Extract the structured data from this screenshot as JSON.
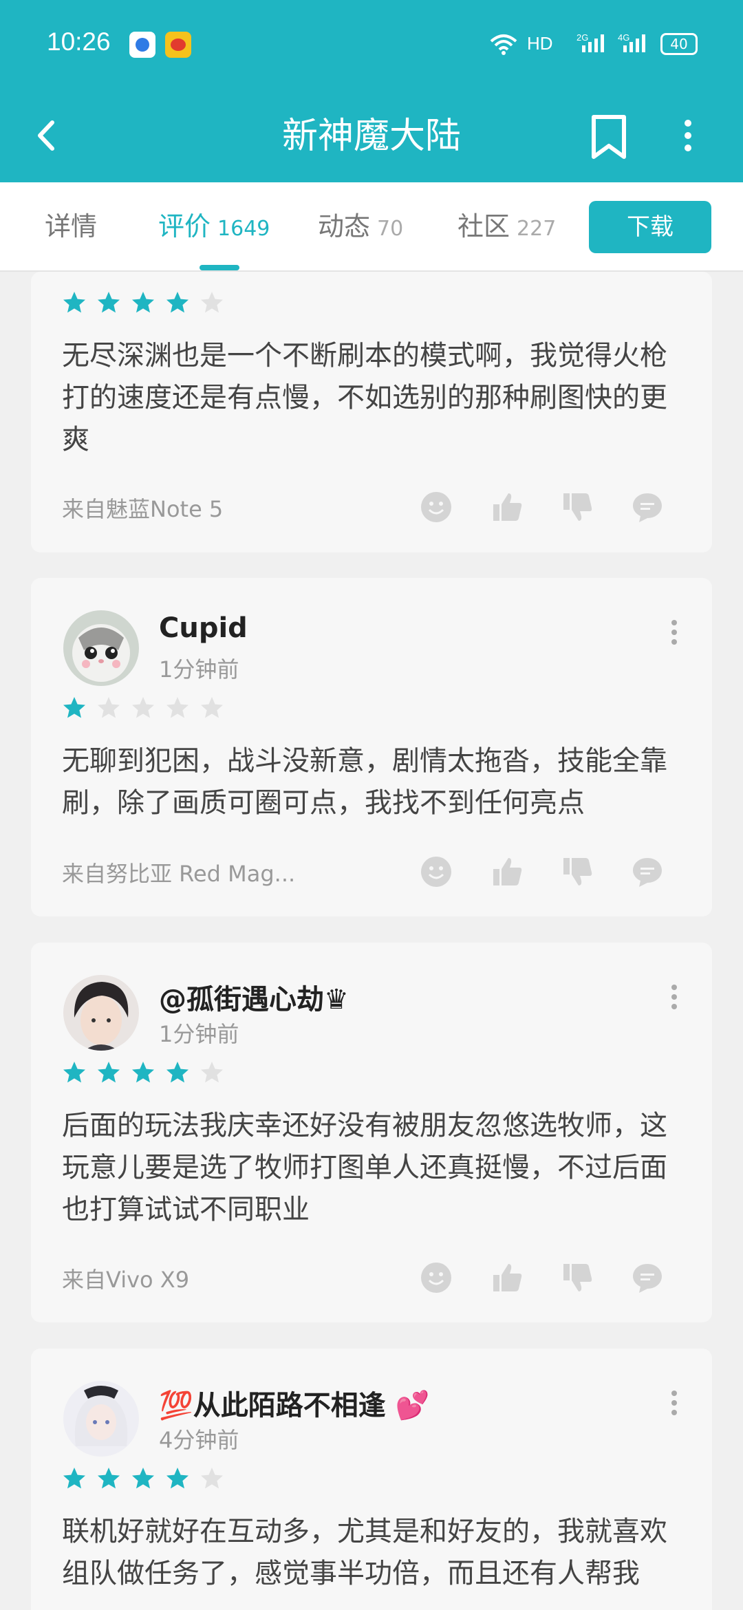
{
  "status_bar": {
    "time": "10:26",
    "network": "HD",
    "signal_1": "2G",
    "signal_2": "4G",
    "battery": "40"
  },
  "header": {
    "title": "新神魔大陆"
  },
  "tabs": [
    {
      "label": "详情",
      "count": ""
    },
    {
      "label": "评价",
      "count": "1649"
    },
    {
      "label": "动态",
      "count": "70"
    },
    {
      "label": "社区",
      "count": "227"
    }
  ],
  "download_label": "下载",
  "colors": {
    "accent": "#1fb5c2",
    "star_empty": "#e1e1e1",
    "card_bg": "#f7f7f7"
  },
  "reviews": [
    {
      "username": "",
      "time": "",
      "rating": 4,
      "content": "无尽深渊也是一个不断刷本的模式啊，我觉得火枪打的速度还是有点慢，不如选别的那种刷图快的更爽",
      "device": "来自魅蓝Note 5"
    },
    {
      "username": "Cupid",
      "time": "1分钟前",
      "rating": 1,
      "content": "无聊到犯困，战斗没新意，剧情太拖沓，技能全靠刷，除了画质可圈可点，我找不到任何亮点",
      "device": "来自努比亚 Red Mag..."
    },
    {
      "username": "@孤街遇心劫♛",
      "time": "1分钟前",
      "rating": 4,
      "content": "后面的玩法我庆幸还好没有被朋友忽悠选牧师，这玩意儿要是选了牧师打图单人还真挺慢，不过后面也打算试试不同职业",
      "device": "来自Vivo X9"
    },
    {
      "username": "💯从此陌路不相逢 💕",
      "time": "4分钟前",
      "rating": 4,
      "content": "联机好就好在互动多，尤其是和好友的，我就喜欢组队做任务了，感觉事半功倍，而且还有人帮我",
      "device": ""
    }
  ]
}
